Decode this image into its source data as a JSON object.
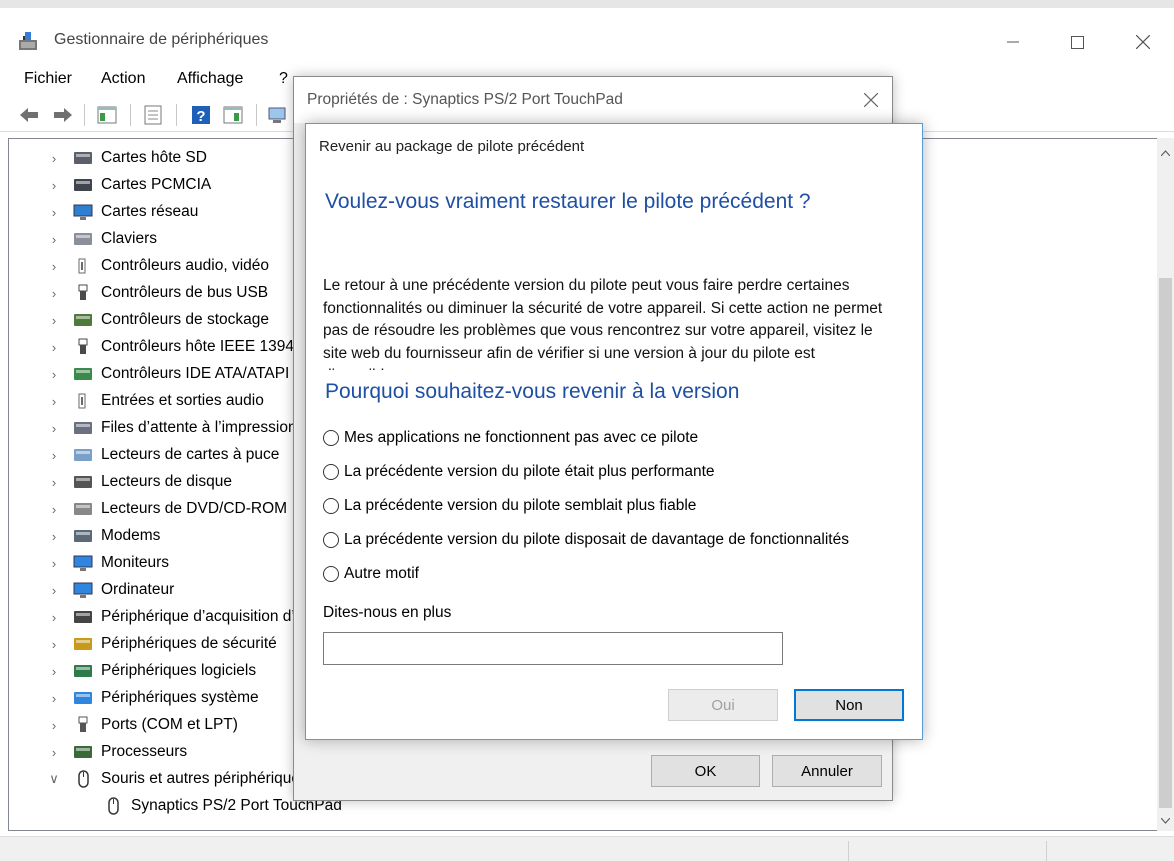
{
  "main_window": {
    "title": "Gestionnaire de périphériques",
    "menu": [
      "Fichier",
      "Action",
      "Affichage",
      "?"
    ],
    "tree": [
      {
        "label": "Cartes hôte SD",
        "expanded": false,
        "icon": "sd-card-icon"
      },
      {
        "label": "Cartes PCMCIA",
        "expanded": false,
        "icon": "pcmcia-icon"
      },
      {
        "label": "Cartes réseau",
        "expanded": false,
        "icon": "network-adapter-icon"
      },
      {
        "label": "Claviers",
        "expanded": false,
        "icon": "keyboard-icon"
      },
      {
        "label": "Contrôleurs audio, vidéo",
        "expanded": false,
        "icon": "audio-icon"
      },
      {
        "label": "Contrôleurs de bus USB",
        "expanded": false,
        "icon": "usb-icon"
      },
      {
        "label": "Contrôleurs de stockage",
        "expanded": false,
        "icon": "storage-icon"
      },
      {
        "label": "Contrôleurs hôte IEEE 1394",
        "expanded": false,
        "icon": "ieee-icon"
      },
      {
        "label": "Contrôleurs IDE ATA/ATAPI",
        "expanded": false,
        "icon": "ide-icon"
      },
      {
        "label": "Entrées et sorties audio",
        "expanded": false,
        "icon": "audio-io-icon"
      },
      {
        "label": "Files d’attente à l’impression",
        "expanded": false,
        "icon": "printer-icon"
      },
      {
        "label": "Lecteurs de cartes à puce",
        "expanded": false,
        "icon": "smartcard-icon"
      },
      {
        "label": "Lecteurs de disque",
        "expanded": false,
        "icon": "disk-icon"
      },
      {
        "label": "Lecteurs de DVD/CD-ROM",
        "expanded": false,
        "icon": "dvd-icon"
      },
      {
        "label": "Modems",
        "expanded": false,
        "icon": "modem-icon"
      },
      {
        "label": "Moniteurs",
        "expanded": false,
        "icon": "monitor-icon"
      },
      {
        "label": "Ordinateur",
        "expanded": false,
        "icon": "computer-icon"
      },
      {
        "label": "Périphérique d’acquisition d’images",
        "expanded": false,
        "icon": "camera-icon"
      },
      {
        "label": "Périphériques de sécurité",
        "expanded": false,
        "icon": "security-icon"
      },
      {
        "label": "Périphériques logiciels",
        "expanded": false,
        "icon": "software-device-icon"
      },
      {
        "label": "Périphériques système",
        "expanded": false,
        "icon": "system-icon"
      },
      {
        "label": "Ports (COM et LPT)",
        "expanded": false,
        "icon": "port-icon"
      },
      {
        "label": "Processeurs",
        "expanded": false,
        "icon": "cpu-icon"
      },
      {
        "label": "Souris et autres périphériques de pointage",
        "expanded": true,
        "icon": "mouse-icon"
      },
      {
        "label": "Synaptics PS/2 Port TouchPad",
        "child": true,
        "icon": "mouse-icon"
      }
    ]
  },
  "properties_dialog": {
    "title": "Propriétés de : Synaptics PS/2 Port TouchPad",
    "ok_label": "OK",
    "cancel_label": "Annuler"
  },
  "rollback_dialog": {
    "header": "Revenir au package de pilote précédent",
    "question": "Voulez-vous vraiment restaurer le pilote précédent ?",
    "body": "Le retour à une précédente version du pilote peut vous faire perdre certaines fonctionnalités ou diminuer la sécurité de votre appareil. Si cette action ne permet pas de résoudre les problèmes que vous rencontrez sur votre appareil, visitez le site web du fournisseur afin de vérifier si une version à jour du pilote est disponible.",
    "why_heading": "Pourquoi souhaitez-vous revenir à la version",
    "reasons": [
      "Mes applications ne fonctionnent pas avec ce pilote",
      "La précédente version du pilote était plus performante",
      "La précédente version du pilote semblait plus fiable",
      "La précédente version du pilote disposait de davantage de fonctionnalités",
      "Autre motif"
    ],
    "tell_more_label": "Dites-nous en plus",
    "tell_more_value": "",
    "yes_label": "Oui",
    "no_label": "Non"
  },
  "colors": {
    "heading_blue": "#1e4fa3",
    "focus_blue": "#0078d7"
  }
}
